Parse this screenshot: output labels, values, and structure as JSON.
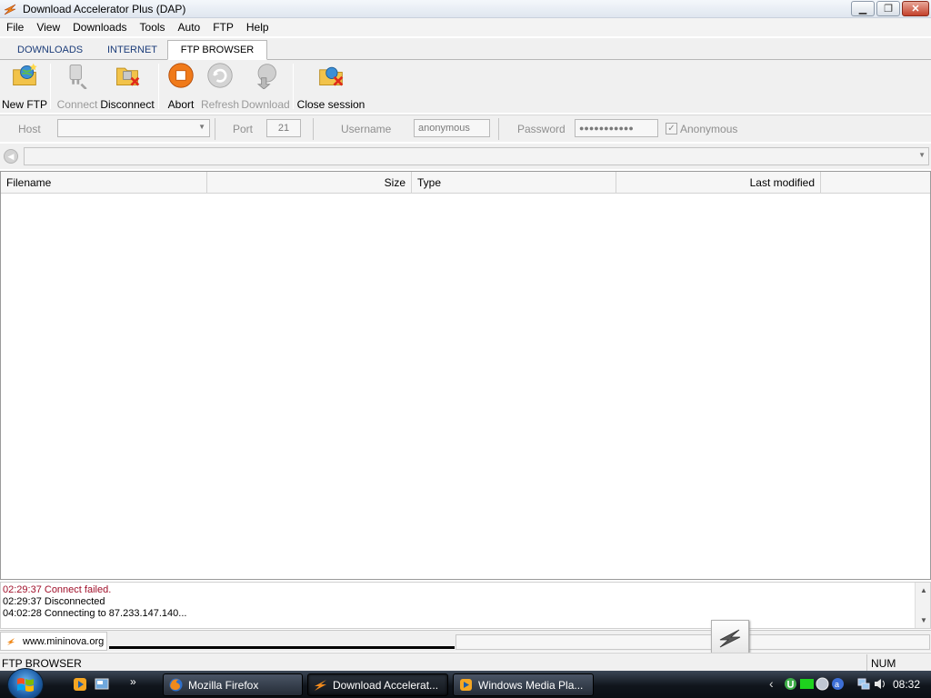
{
  "window": {
    "title": "Download Accelerator Plus (DAP)"
  },
  "menu": [
    "File",
    "View",
    "Downloads",
    "Tools",
    "Auto",
    "FTP",
    "Help"
  ],
  "tabs": [
    {
      "label": "DOWNLOADS",
      "active": false
    },
    {
      "label": "INTERNET",
      "active": false
    },
    {
      "label": "FTP BROWSER",
      "active": true
    }
  ],
  "toolbar": {
    "new_ftp": "New FTP",
    "connect": "Connect",
    "disconnect": "Disconnect",
    "abort": "Abort",
    "refresh": "Refresh",
    "download": "Download",
    "close_session": "Close session"
  },
  "connection": {
    "host_label": "Host",
    "host_value": "",
    "port_label": "Port",
    "port_value": "21",
    "username_label": "Username",
    "username_value": "anonymous",
    "password_label": "Password",
    "password_value": "●●●●●●●●●●●",
    "anonymous_label": "Anonymous",
    "anonymous_checked": true
  },
  "path": {
    "value": ""
  },
  "filelist": {
    "columns": [
      "Filename",
      "Size",
      "Type",
      "Last modified"
    ],
    "rows": []
  },
  "log": [
    {
      "text": "02:29:37 Connect failed.",
      "color": "#a0102a"
    },
    {
      "text": "02:29:37 Disconnected",
      "color": "#000000"
    },
    {
      "text": "04:02:28 Connecting to 87.233.147.140...",
      "color": "#000000"
    }
  ],
  "bottom_tab": {
    "label": "www.mininova.org"
  },
  "status": {
    "text": "FTP BROWSER",
    "num": "NUM"
  },
  "taskbar": {
    "tasks": [
      {
        "label": "Mozilla Firefox",
        "icon": "firefox-icon"
      },
      {
        "label": "Download Accelerat...",
        "icon": "dap-icon"
      },
      {
        "label": "Windows Media Pla...",
        "icon": "media-player-icon"
      }
    ],
    "quick_more": "»",
    "clock": "08:32"
  }
}
